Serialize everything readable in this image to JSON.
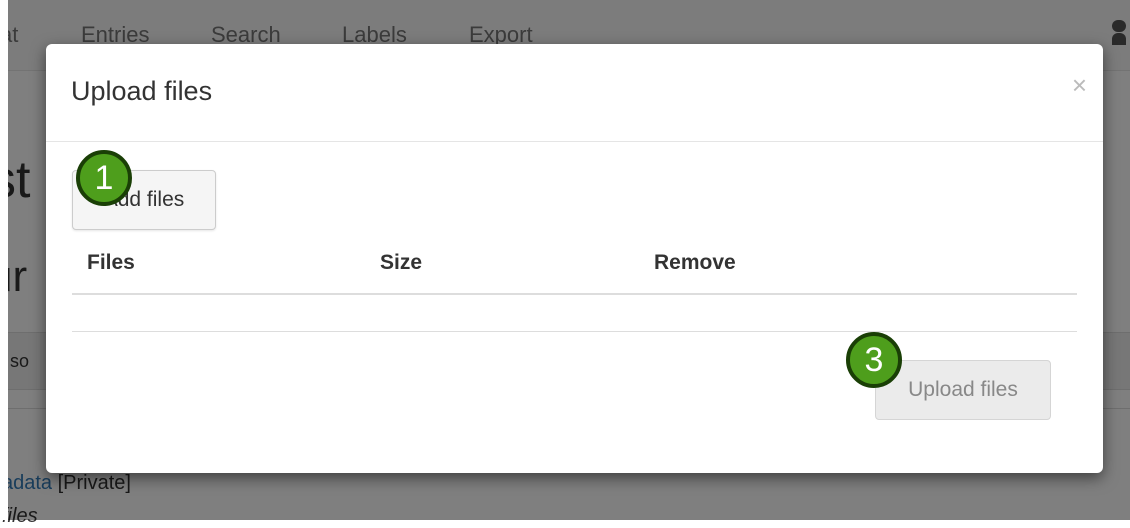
{
  "background_page": {
    "nav_items": [
      "at",
      "Entries",
      "Search",
      "Labels",
      "Export"
    ],
    "heading_fragment": "st",
    "subheading_fragment": "ur",
    "sort_bar_fragment": "/ so",
    "entry": {
      "link_text": "adata",
      "visibility": "[Private]"
    },
    "files_label": "files"
  },
  "modal": {
    "title": "Upload files",
    "close_glyph": "×",
    "add_button_label": "Add files",
    "table": {
      "columns": [
        "Files",
        "Size",
        "Remove"
      ],
      "rows": []
    },
    "upload_button_label": "Upload files",
    "upload_button_disabled": true
  },
  "step_badges": [
    "1",
    "3"
  ],
  "colors": {
    "badge_fill": "#4e9e1c",
    "badge_border": "#1a3f06",
    "link": "#337ab7"
  }
}
